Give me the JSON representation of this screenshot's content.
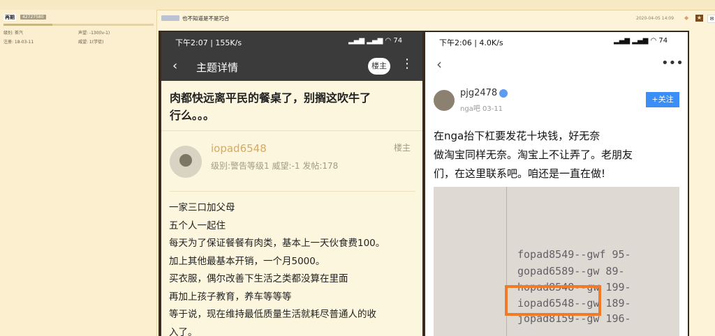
{
  "sidebar": {
    "username": "再期",
    "uid": "42727580",
    "level_label": "级别: 茶汽",
    "reputation_label": "声望: -130(lv-1)",
    "register_label": "注册: 18-03-11",
    "prestige_label": "威望: 1(学徒)"
  },
  "post": {
    "title": "也不知道是不是巧合",
    "time": "2020-04-05 14:09"
  },
  "phone1": {
    "status_time": "下午2:07 | 155K/s",
    "status_right": "74",
    "nav_title": "主题详情",
    "owner_badge": "楼主",
    "headline_line1": "肉都快远离平民的餐桌了，别搁这吹牛了",
    "headline_line2": "行么。。。",
    "user_name": "iopad6548",
    "user_stats": "级别:警告等级1   威望:-1   发帖:178",
    "user_tag": "楼主",
    "body": [
      "一家三口加父母",
      "五个人一起住",
      "每天为了保证餐餐有肉类，基本上一天伙食费100。",
      "加上其他最基本开销，一个月5000。",
      "买衣服，偶尔改善下生活之类都没算在里面",
      "再加上孩子教育，养车等等等",
      "等于说，现在维持最低质量生活就耗尽普通人的收",
      "入了。"
    ]
  },
  "phone2": {
    "status_time": "下午2:06 | 4.0K/s",
    "status_right": "74",
    "user_name": "pjg2478",
    "user_sub": "nga吧    03-11",
    "follow_label": "+关注",
    "body": [
      "在nga抬下杠要发花十块钱，好无奈",
      "做淘宝同样无奈。淘宝上不让弄了。老朋友",
      "们，在这里联系吧。咱还是一直在做!"
    ],
    "photo_rows": [
      "fopad8549--gwf   95-",
      "gopad6589--gw    89-",
      "hopad8548--gw   199-",
      "iopad6548--gw   189-",
      "jopad8159--gw   196-"
    ]
  },
  "colors": {
    "accent_orange": "#f07a2a",
    "follow_blue": "#3a8ef6",
    "username_gold": "#d8a960"
  }
}
